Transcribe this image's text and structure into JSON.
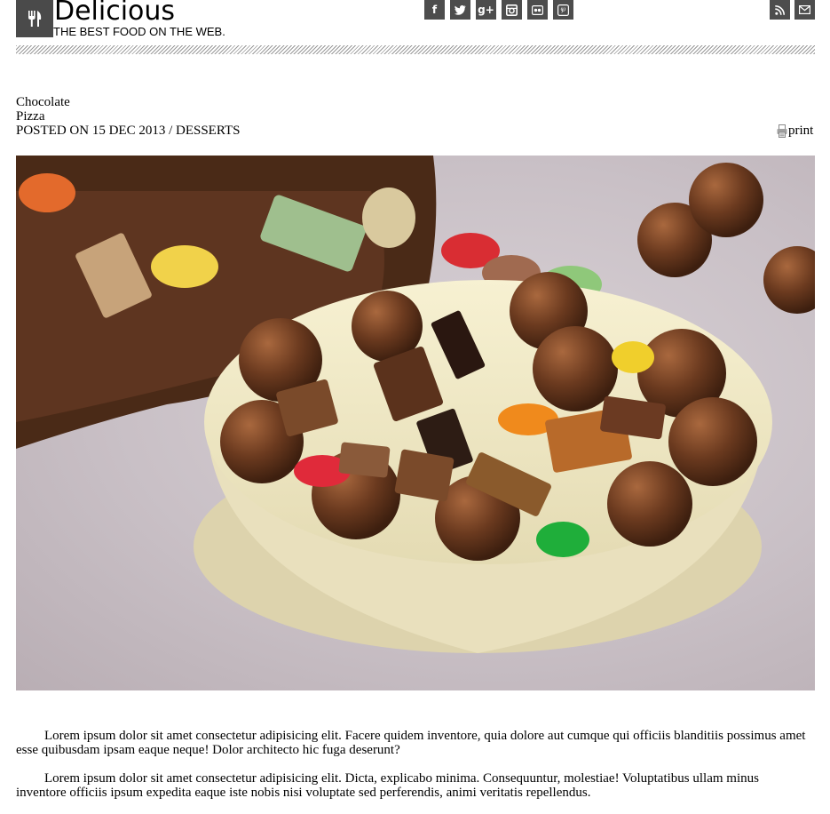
{
  "header": {
    "site_title": "Delicious",
    "tagline": "THE BEST FOOD ON THE WEB.",
    "logo_icon": "fork-knife-icon",
    "social_icons": [
      "facebook-icon",
      "twitter-icon",
      "google-plus-icon",
      "instagram-icon",
      "flickr-icon",
      "pinterest-icon"
    ],
    "social_glyphs": {
      "facebook": "f",
      "google_plus": "g+"
    },
    "utility_icons": [
      "rss-icon",
      "email-icon"
    ]
  },
  "post": {
    "title_line1": "Chocolate",
    "title_line2": "Pizza",
    "meta": "POSTED ON 15 DEC 2013 / DESSERTS",
    "print_label": "print",
    "image_alt": "Chocolate pizza dessert topped with candies",
    "paragraphs": [
      "Lorem ipsum dolor sit amet consectetur adipisicing elit. Facere quidem inventore, quia dolore aut cumque qui officiis blanditiis possimus amet esse quibusdam ipsam eaque neque! Dolor architecto hic fuga deserunt?",
      "Lorem ipsum dolor sit amet consectetur adipisicing elit. Dicta, explicabo minima. Consequuntur, molestiae! Voluptatibus ullam minus inventore officiis ipsum expedita eaque iste nobis nisi voluptate sed perferendis, animi veritatis repellendus."
    ]
  },
  "colors": {
    "icon_bg": "#4d4d4d",
    "logo_bg": "#4a4a4a"
  }
}
